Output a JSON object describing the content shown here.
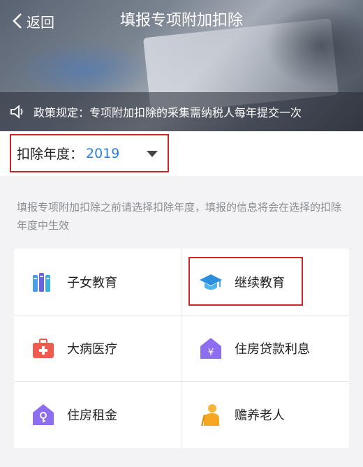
{
  "header": {
    "back_label": "返回",
    "title": "填报专项附加扣除",
    "notice": "政策规定：专项附加扣除的采集需纳税人每年提交一次"
  },
  "year_selector": {
    "label": "扣除年度：",
    "value": "2019"
  },
  "hint": "填报专项附加扣除之前请选择扣除年度，填报的信息将会在选择的扣除年度中生效",
  "categories": [
    {
      "label": "子女教育",
      "icon": "books-icon"
    },
    {
      "label": "继续教育",
      "icon": "graduation-cap-icon"
    },
    {
      "label": "大病医疗",
      "icon": "medical-kit-icon"
    },
    {
      "label": "住房贷款利息",
      "icon": "house-yuan-icon"
    },
    {
      "label": "住房租金",
      "icon": "house-key-icon"
    },
    {
      "label": "赡养老人",
      "icon": "elderly-person-icon"
    }
  ],
  "colors": {
    "accent_blue": "#2f7ed8",
    "highlight_red": "#d3232a"
  }
}
